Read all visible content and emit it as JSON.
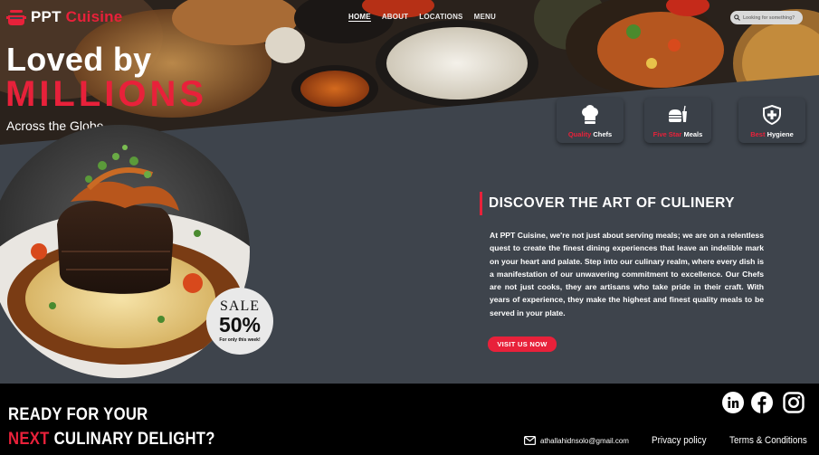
{
  "brand": {
    "name_part1": "PPT",
    "name_part2": "Cuisine"
  },
  "nav": {
    "items": [
      "HOME",
      "ABOUT",
      "LOCATIONS",
      "MENU"
    ],
    "active": "HOME"
  },
  "search": {
    "placeholder": "Looking for something?"
  },
  "hero": {
    "line1": "Loved by",
    "line2": "MILLIONS",
    "line3": "Across the Globe"
  },
  "features": [
    {
      "icon": "chef-hat-icon",
      "accent": "Quality",
      "rest": "Chefs"
    },
    {
      "icon": "burger-drink-icon",
      "accent": "Five Star",
      "rest": "Meals"
    },
    {
      "icon": "shield-plus-icon",
      "accent": "Best",
      "rest": "Hygiene"
    }
  ],
  "sale": {
    "word": "SALE",
    "percent": "50%",
    "note": "For only this week!"
  },
  "discover": {
    "title": "DISCOVER THE ART OF CULINERY",
    "body": "At PPT Cuisine, we're not just about serving meals; we are on a relentless quest to create the finest dining experiences that leave an indelible mark on your heart and palate. Step into our culinary realm, where every dish is a manifestation of our unwavering commitment to excellence. Our Chefs are not just cooks, they are artisans who take pride in their craft. With years of experience, they make the highest and finest quality meals to be served in your plate.",
    "cta": "VISIT US NOW"
  },
  "footer": {
    "line1": "READY FOR YOUR",
    "line2_accent": "NEXT",
    "line2_rest": "CULINARY DELIGHT?",
    "email": "athallahidnsolo@gmail.com",
    "privacy": "Privacy policy",
    "terms": "Terms & Conditions",
    "social": [
      "linkedin-icon",
      "facebook-icon",
      "instagram-icon"
    ]
  },
  "colors": {
    "accent": "#e8213a",
    "panel": "#3e444c",
    "footer": "#000000"
  }
}
